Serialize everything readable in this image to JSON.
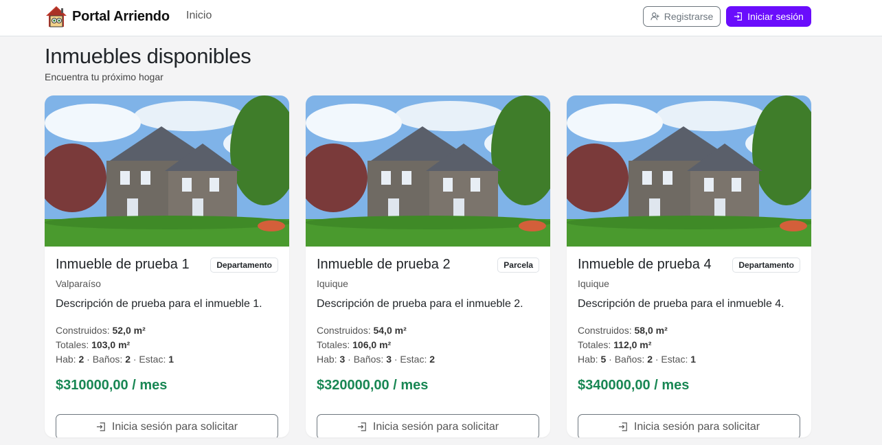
{
  "navbar": {
    "brand": "Portal Arriendo",
    "nav_inicio": "Inicio",
    "register_label": "Registrarse",
    "login_label": "Iniciar sesión"
  },
  "page": {
    "title": "Inmuebles disponibles",
    "subtitle": "Encuentra tu próximo hogar"
  },
  "labels": {
    "construidos": "Construidos: ",
    "totales": "Totales: ",
    "hab": "Hab: ",
    "banos": " · Baños: ",
    "estac": " · Estac: "
  },
  "cards": [
    {
      "title": "Inmueble de prueba 1",
      "badge": "Departamento",
      "city": "Valparaíso",
      "description": "Descripción de prueba para el inmueble 1.",
      "construidos": "52,0 m²",
      "totales": "103,0 m²",
      "hab": "2",
      "banos": "2",
      "estac": "1",
      "price": "$310000,00 / mes",
      "button": "Inicia sesión para solicitar"
    },
    {
      "title": "Inmueble de prueba 2",
      "badge": "Parcela",
      "city": "Iquique",
      "description": "Descripción de prueba para el inmueble 2.",
      "construidos": "54,0 m²",
      "totales": "106,0 m²",
      "hab": "3",
      "banos": "3",
      "estac": "2",
      "price": "$320000,00 / mes",
      "button": "Inicia sesión para solicitar"
    },
    {
      "title": "Inmueble de prueba 4",
      "badge": "Departamento",
      "city": "Iquique",
      "description": "Descripción de prueba para el inmueble 4.",
      "construidos": "58,0 m²",
      "totales": "112,0 m²",
      "hab": "5",
      "banos": "2",
      "estac": "1",
      "price": "$340000,00 / mes",
      "button": "Inicia sesión para solicitar"
    }
  ],
  "colors": {
    "primary": "#6a0dfc",
    "price": "#198754",
    "background": "#f4f4f5"
  },
  "icons": {
    "brand": "house-logo-icon",
    "register": "user-plus-icon",
    "login": "login-icon",
    "request": "login-icon"
  }
}
